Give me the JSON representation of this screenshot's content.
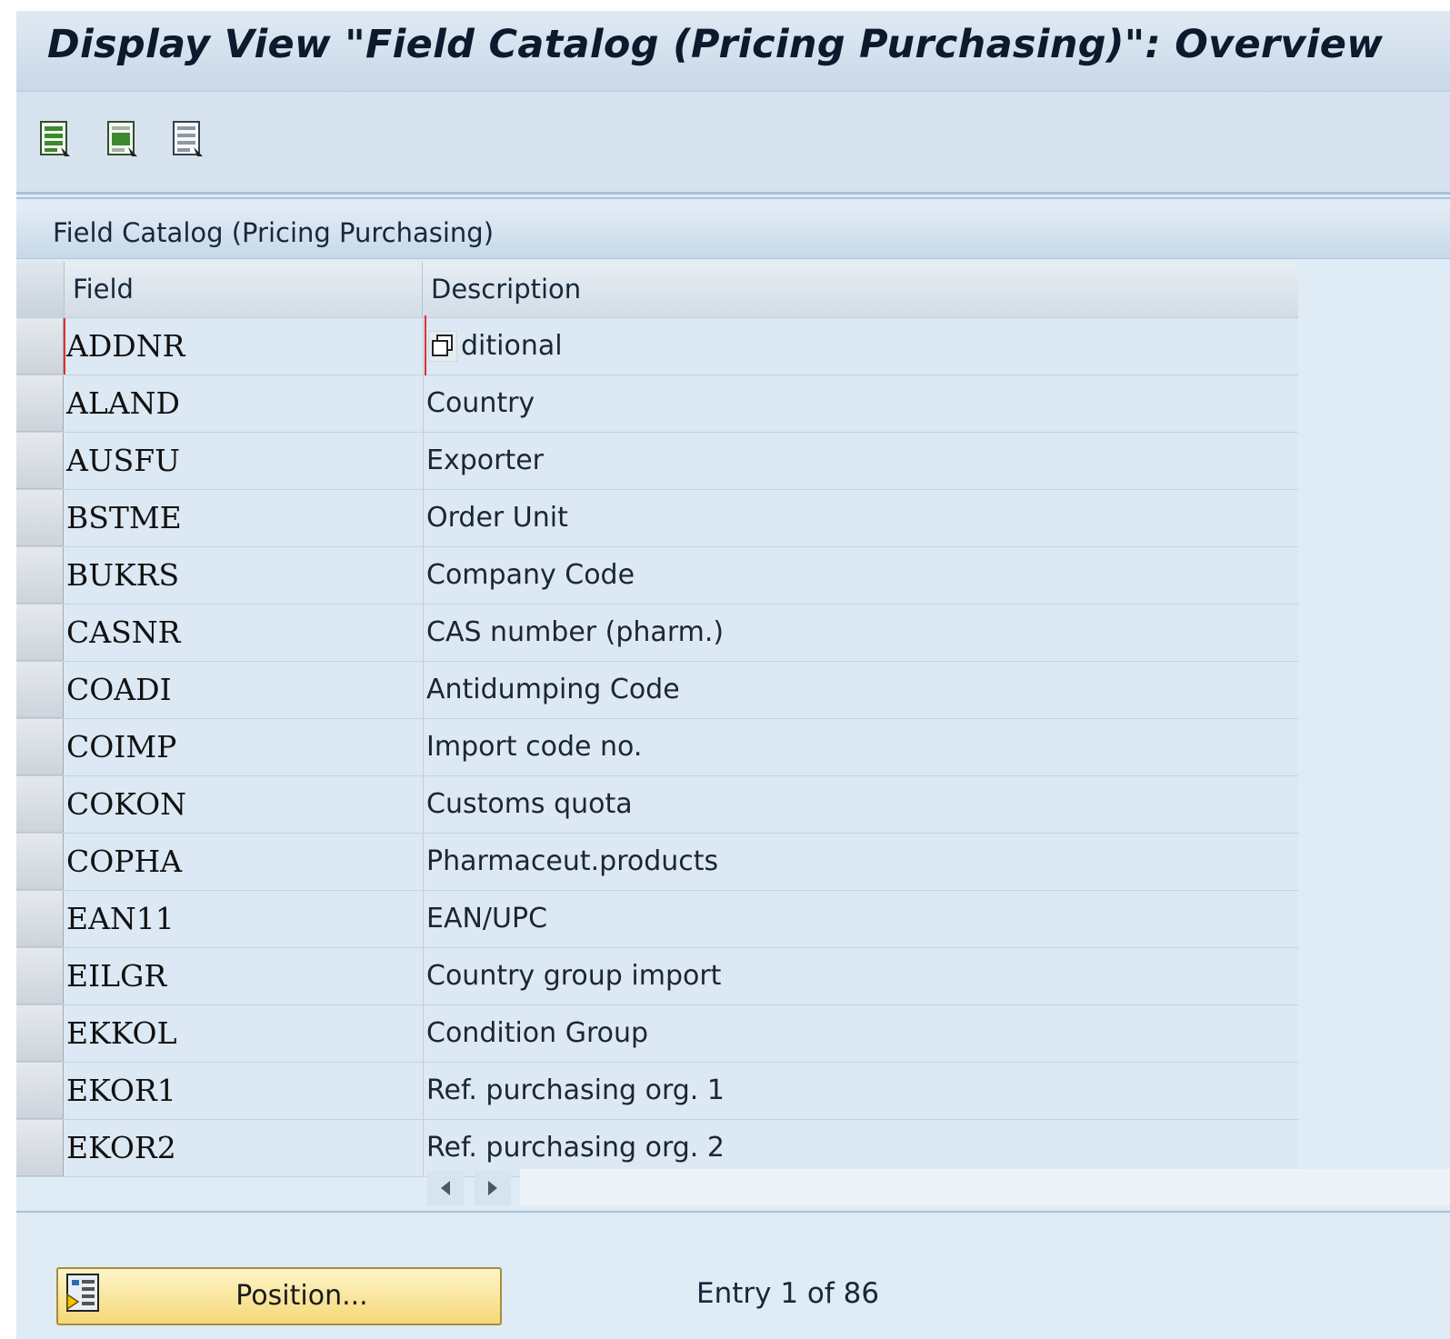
{
  "window": {
    "title": "Display View \"Field Catalog (Pricing Purchasing)\": Overview"
  },
  "toolbar": {
    "buttons": [
      {
        "icon": "select-all-icon"
      },
      {
        "icon": "select-block-icon"
      },
      {
        "icon": "deselect-all-icon"
      }
    ]
  },
  "table": {
    "title": "Field Catalog (Pricing Purchasing)",
    "columns": [
      "Field",
      "Description"
    ],
    "rows": [
      {
        "field": "ADDNR",
        "description": "ditional"
      },
      {
        "field": "ALAND",
        "description": "Country"
      },
      {
        "field": "AUSFU",
        "description": "Exporter"
      },
      {
        "field": "BSTME",
        "description": "Order Unit"
      },
      {
        "field": "BUKRS",
        "description": "Company Code"
      },
      {
        "field": "CASNR",
        "description": "CAS number (pharm.)"
      },
      {
        "field": "COADI",
        "description": "Antidumping Code"
      },
      {
        "field": "COIMP",
        "description": "Import code no."
      },
      {
        "field": "COKON",
        "description": "Customs quota"
      },
      {
        "field": "COPHA",
        "description": "Pharmaceut.products"
      },
      {
        "field": "EAN11",
        "description": "EAN/UPC"
      },
      {
        "field": "EILGR",
        "description": "Country group import"
      },
      {
        "field": "EKKOL",
        "description": "Condition Group"
      },
      {
        "field": "EKOR1",
        "description": "Ref. purchasing org. 1"
      },
      {
        "field": "EKOR2",
        "description": "Ref. purchasing org. 2"
      }
    ]
  },
  "footer": {
    "position_button": "Position...",
    "entry_info": "Entry 1 of 86"
  }
}
